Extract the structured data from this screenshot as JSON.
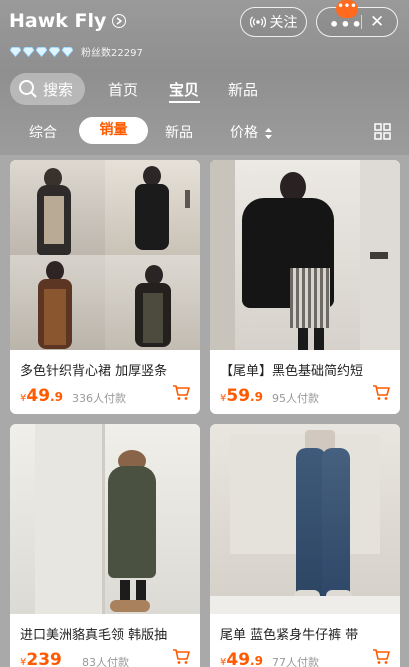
{
  "shop": {
    "name": "Hawk Fly",
    "fans_label": "粉丝数22297",
    "follow_label": "关注",
    "more_label": "•••",
    "close_label": "✕",
    "notice_label": "•••"
  },
  "nav": {
    "search_label": "搜索",
    "tabs": [
      {
        "label": "首页"
      },
      {
        "label": "宝贝"
      },
      {
        "label": "新品"
      }
    ]
  },
  "filters": [
    {
      "label": "综合"
    },
    {
      "label": "销量"
    },
    {
      "label": "新品"
    },
    {
      "label": "价格"
    }
  ],
  "products": [
    {
      "title": "多色针织背心裙 加厚竖条",
      "price_yen": "¥",
      "price_main": "49",
      "price_dec": ".9",
      "sales": "336人付款"
    },
    {
      "title": "【尾单】黑色基础简约短",
      "price_yen": "¥",
      "price_main": "59",
      "price_dec": ".9",
      "sales": "95人付款"
    },
    {
      "title": "进口美洲貉真毛领 韩版抽",
      "price_yen": "¥",
      "price_main": "239",
      "price_dec": "",
      "sales": "83人付款"
    },
    {
      "title": "尾单  蓝色紧身牛仔裤 带",
      "price_yen": "¥",
      "price_main": "49",
      "price_dec": ".9",
      "sales": "77人付款"
    }
  ],
  "colors": {
    "accent": "#ff5a00",
    "header_bg": "#9a9a9a",
    "page_bg": "#a9a9a9"
  },
  "icons": [
    "info-arrow-icon",
    "diamond-icon",
    "broadcast-icon",
    "search-icon",
    "sort-icon",
    "grid-view-icon",
    "cart-icon"
  ]
}
